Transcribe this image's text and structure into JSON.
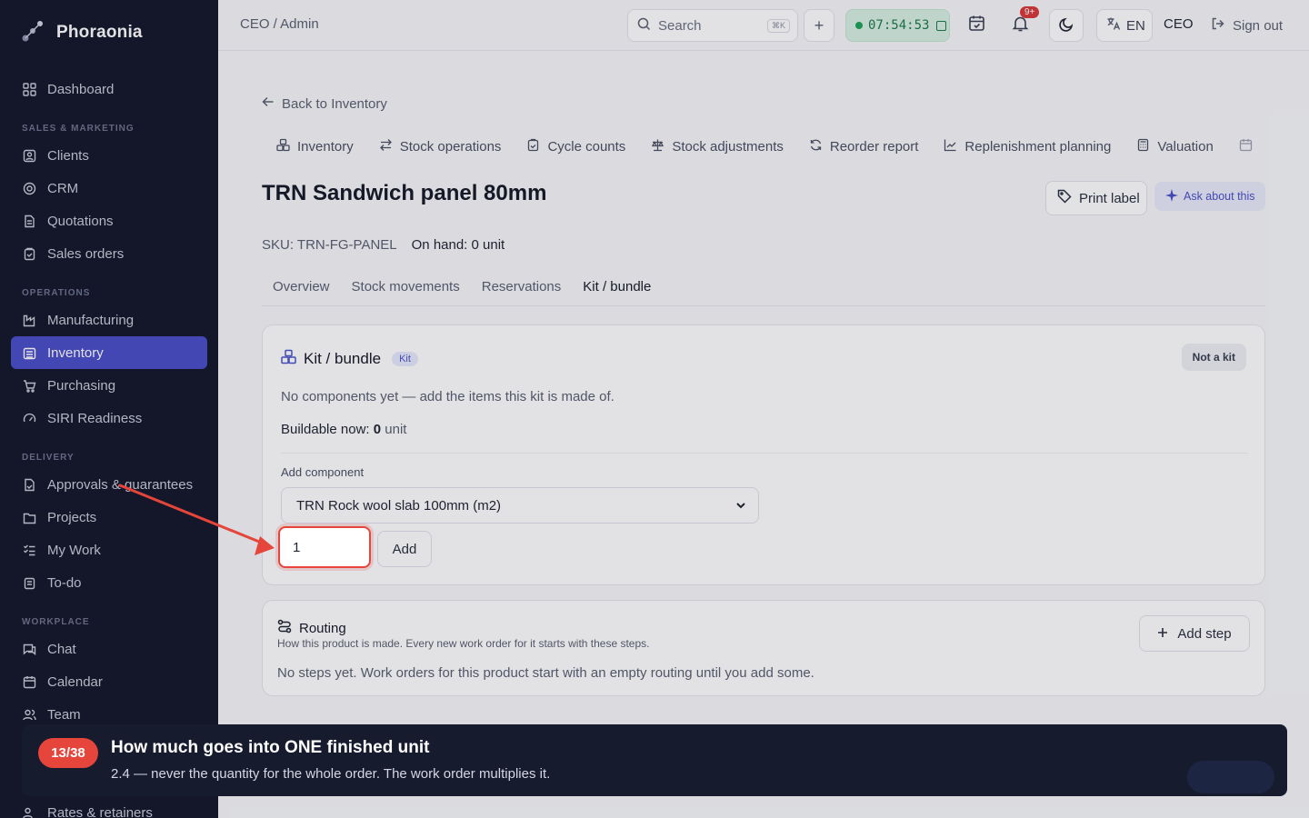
{
  "app": {
    "name": "Phoraonia"
  },
  "sidebar": {
    "dashboard": "Dashboard",
    "sections": {
      "sales": "SALES & MARKETING",
      "operations": "OPERATIONS",
      "delivery": "DELIVERY",
      "workplace": "WORKPLACE"
    },
    "items": {
      "clients": "Clients",
      "crm": "CRM",
      "quotations": "Quotations",
      "sales_orders": "Sales orders",
      "manufacturing": "Manufacturing",
      "inventory": "Inventory",
      "purchasing": "Purchasing",
      "siri": "SIRI Readiness",
      "approvals": "Approvals & guarantees",
      "projects": "Projects",
      "my_work": "My Work",
      "todo": "To-do",
      "chat": "Chat",
      "calendar": "Calendar",
      "team": "Team",
      "rates": "Rates & retainers"
    }
  },
  "topbar": {
    "breadcrumb": "CEO / Admin",
    "search_placeholder": "Search",
    "search_shortcut": "⌘K",
    "timer": "07:54:53",
    "notifications_badge": "9+",
    "language": "EN",
    "role": "CEO",
    "signout": "Sign out"
  },
  "page": {
    "back_link": "Back to Inventory",
    "subnav": {
      "inventory": "Inventory",
      "stock_operations": "Stock operations",
      "cycle_counts": "Cycle counts",
      "stock_adjustments": "Stock adjustments",
      "reorder_report": "Reorder report",
      "replenishment": "Replenishment planning",
      "valuation": "Valuation"
    },
    "title": "TRN Sandwich panel 80mm",
    "print_label": "Print label",
    "ask_about": "Ask about this",
    "sku": "SKU: TRN-FG-PANEL",
    "on_hand": "On hand: 0 unit",
    "tabs": {
      "overview": "Overview",
      "movements": "Stock movements",
      "reservations": "Reservations",
      "kit": "Kit / bundle"
    }
  },
  "kit": {
    "heading": "Kit / bundle",
    "badge": "Kit",
    "status": "Not a kit",
    "empty": "No components yet — add the items this kit is made of.",
    "buildable_label": "Buildable now:",
    "buildable_value": "0",
    "buildable_unit": "unit",
    "add_component_label": "Add component",
    "selected_component": "TRN Rock wool slab 100mm (m2)",
    "quantity": "1",
    "add_button": "Add"
  },
  "routing": {
    "heading": "Routing",
    "subtitle": "How this product is made. Every new work order for it starts with these steps.",
    "empty": "No steps yet. Work orders for this product start with an empty routing until you add some.",
    "add_step": "Add step"
  },
  "tour": {
    "step": "13/38",
    "title": "How much goes into ONE finished unit",
    "body": "2.4 — never the quantity for the whole order. The work order multiplies it."
  },
  "colors": {
    "sidebar_bg": "#14182b",
    "active_nav": "#4b4fc8",
    "highlight": "#e5453b",
    "timer_bg": "#d8f1e3"
  }
}
